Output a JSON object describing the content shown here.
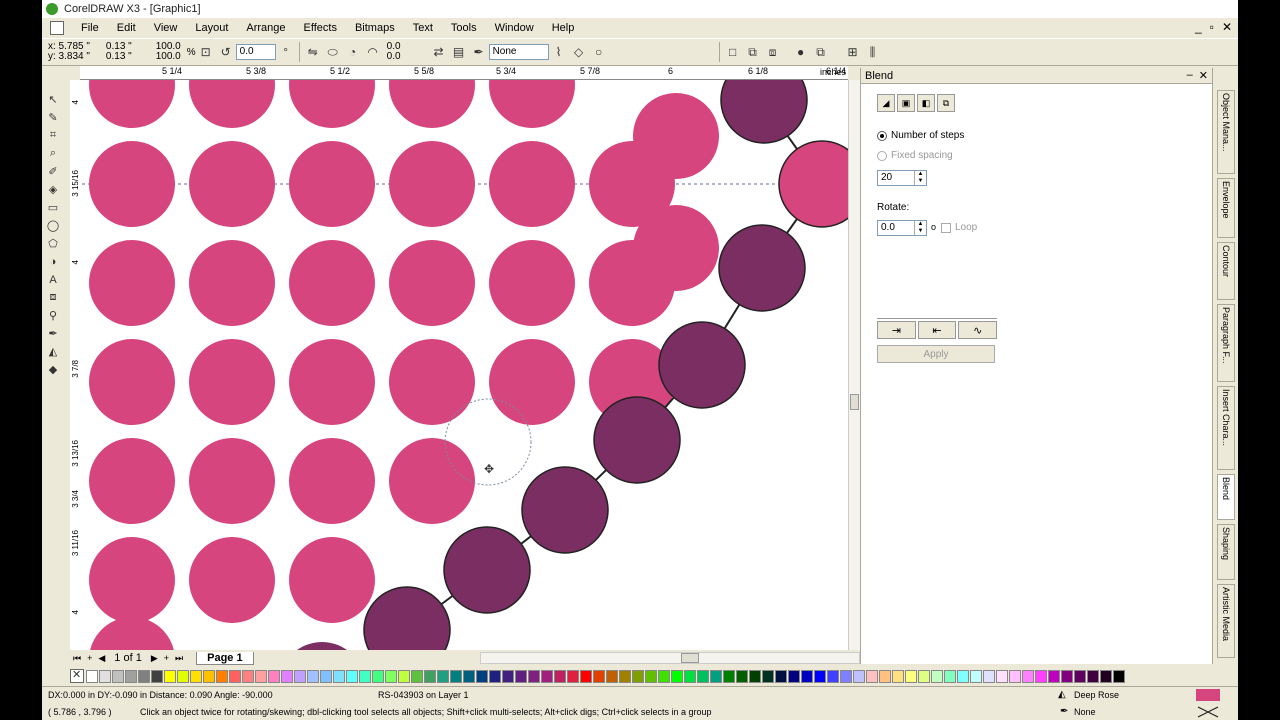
{
  "window": {
    "title": "CorelDRAW X3 - [Graphic1]",
    "win_min": "_",
    "win_max": "▫",
    "win_close": "✕"
  },
  "menu": [
    "File",
    "Edit",
    "View",
    "Layout",
    "Arrange",
    "Effects",
    "Bitmaps",
    "Text",
    "Tools",
    "Window",
    "Help"
  ],
  "propbar": {
    "x": "x:  5.785 \"",
    "y": "y:  3.834 \"",
    "w": "0.13 \"",
    "h": "0.13 \"",
    "sx": "100.0",
    "sy": "100.0",
    "pct": "%",
    "angle": "0.0",
    "skew_x": "0.0",
    "skew_y": "0.0",
    "wrap": "None"
  },
  "ruler": {
    "h_ticks": [
      "5 1/4",
      "5 3/8",
      "5 1/2",
      "5 5/8",
      "5 3/4",
      "5 7/8",
      "6",
      "6 1/8",
      "6 1/4"
    ],
    "h_units": "inches",
    "v_ticks": [
      "4",
      "3 15/16",
      "4",
      "3 7/8",
      "3 13/16",
      "3 3/4",
      "3 11/16",
      "4"
    ]
  },
  "pagebar": {
    "count": "1 of 1",
    "tab": "Page 1"
  },
  "docker": {
    "title": "Blend",
    "num_steps_label": "Number of steps",
    "fixed_spacing_label": "Fixed spacing",
    "steps_value": "20",
    "rotate_label": "Rotate:",
    "rotate_value": "0.0",
    "rotate_unit": "o",
    "loop_label": "Loop",
    "apply_label": "Apply"
  },
  "docker_tabs": [
    "Object Mana...",
    "Envelope",
    "Contour",
    "Paragraph F...",
    "Insert Chara...",
    "Blend",
    "Shaping",
    "Artistic Media"
  ],
  "status": {
    "line1": "DX:0.000 in DY:-0.090 in Distance: 0.090 Angle: -90.000",
    "layer": "RS-043903 on Layer 1",
    "line2": "( 5.786 , 3.796 )",
    "hint": "Click an object twice for rotating/skewing; dbl-clicking tool selects all objects; Shift+click multi-selects; Alt+click digs; Ctrl+click selects in a group",
    "fill_name": "Deep Rose",
    "outline_name": "None",
    "fill_color": "#d6457e"
  },
  "colors": {
    "pink": "#d6457e",
    "plum": "#7a2e62"
  },
  "palette": [
    "#ffffff",
    "#e0e0e0",
    "#c0c0c0",
    "#a0a0a0",
    "#808080",
    "#404040",
    "#ffff00",
    "#e0ff00",
    "#ffe000",
    "#ffc000",
    "#ff8000",
    "#ff6060",
    "#ff8080",
    "#ffa0a0",
    "#ff80c0",
    "#e080ff",
    "#c0a0ff",
    "#a0c0ff",
    "#80c0ff",
    "#80e0ff",
    "#60ffff",
    "#40ffc0",
    "#40ff80",
    "#80ff60",
    "#c0ff40",
    "#60c040",
    "#40a060",
    "#20a080",
    "#008080",
    "#006080",
    "#004080",
    "#202080",
    "#402080",
    "#602080",
    "#802080",
    "#a02080",
    "#c02060",
    "#e02040",
    "#ff0000",
    "#e04000",
    "#c06000",
    "#a08000",
    "#80a000",
    "#60c000",
    "#40e000",
    "#00ff00",
    "#00e040",
    "#00c060",
    "#00a080",
    "#008000",
    "#006000",
    "#004000",
    "#003020",
    "#001040",
    "#000080",
    "#0000c0",
    "#0000ff",
    "#4040ff",
    "#8080ff",
    "#c0c0ff",
    "#ffc0c0",
    "#ffc080",
    "#ffe080",
    "#ffff80",
    "#e0ff80",
    "#c0ffc0",
    "#80ffc0",
    "#80ffff",
    "#c0ffff",
    "#e0e0ff",
    "#ffe0ff",
    "#ffc0ff",
    "#ff80ff",
    "#ff40ff",
    "#c000c0",
    "#800080",
    "#600060",
    "#400040",
    "#200020",
    "#000000"
  ]
}
